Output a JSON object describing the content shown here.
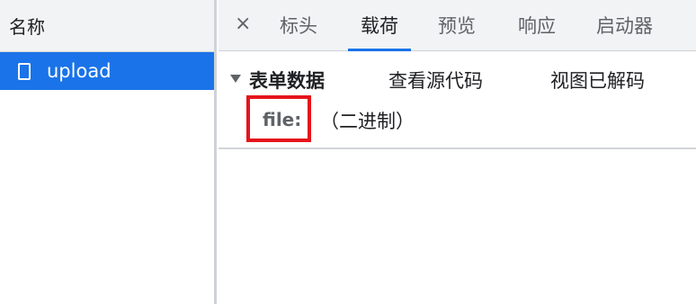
{
  "request_list": {
    "header": "名称",
    "items": [
      {
        "name": "upload",
        "icon": "document-icon",
        "selected": true
      }
    ]
  },
  "detail": {
    "close_icon": "×",
    "tabs": [
      {
        "label": "标头",
        "active": false
      },
      {
        "label": "载荷",
        "active": true
      },
      {
        "label": "预览",
        "active": false
      },
      {
        "label": "响应",
        "active": false
      },
      {
        "label": "启动器",
        "active": false
      }
    ],
    "section": {
      "title": "表单数据",
      "view_source": "查看源代码",
      "view_decoded": "视图已解码"
    },
    "fields": [
      {
        "key": "file:",
        "value": "（二进制）"
      }
    ]
  },
  "colors": {
    "accent": "#1a73e8",
    "highlight": "#e5141b",
    "header_bg": "#f1f3f4"
  }
}
